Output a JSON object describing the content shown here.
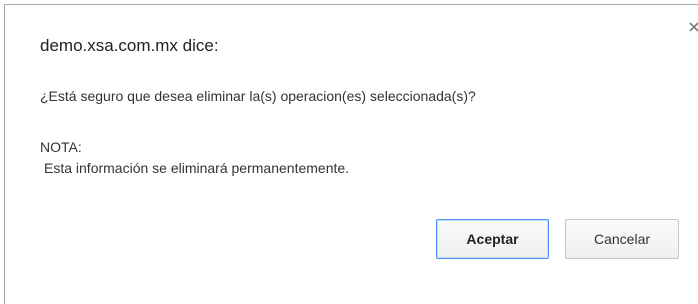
{
  "dialog": {
    "title": "demo.xsa.com.mx dice:",
    "message": "¿Está seguro que desea eliminar la(s) operacion(es) seleccionada(s)?",
    "note_label": "NOTA:",
    "note_text": "Esta información se eliminará permanentemente.",
    "close_icon": "close-icon"
  },
  "buttons": {
    "accept_label": "Aceptar",
    "cancel_label": "Cancelar"
  },
  "colors": {
    "accent_border": "#4d90fe",
    "dialog_border": "#a8a8a8",
    "text": "#333333"
  }
}
